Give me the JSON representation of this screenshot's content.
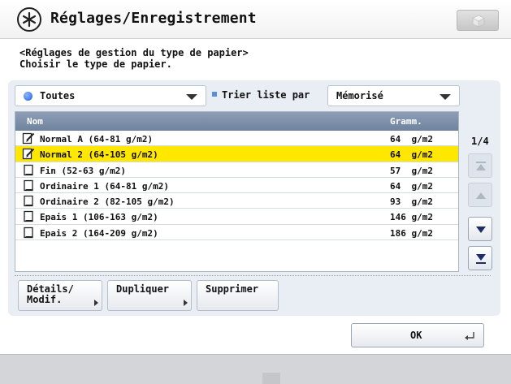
{
  "titlebar": {
    "title": "Réglages/Enregistrement",
    "icon": "settings-registration-icon",
    "right_button_icon": "box-icon"
  },
  "instructions": {
    "line1": "<Réglages de gestion du type de papier>",
    "line2": "Choisir le type de papier."
  },
  "filter": {
    "selected": "Toutes",
    "icon": "blue-dot-icon"
  },
  "sort": {
    "label": "Trier liste par",
    "selected": "Mémorisé"
  },
  "table": {
    "headers": {
      "name": "Nom",
      "weight": "Gramm."
    },
    "rows": [
      {
        "name": "Normal A (64-81 g/m2)",
        "weight": "64  g/m2",
        "icon": "edit-paper-icon",
        "selected": false
      },
      {
        "name": "Normal 2 (64-105 g/m2)",
        "weight": "64  g/m2",
        "icon": "edit-paper-icon",
        "selected": true
      },
      {
        "name": "Fin (52-63 g/m2)",
        "weight": "57  g/m2",
        "icon": "paper-icon",
        "selected": false
      },
      {
        "name": "Ordinaire 1 (64-81 g/m2)",
        "weight": "64  g/m2",
        "icon": "paper-icon",
        "selected": false
      },
      {
        "name": "Ordinaire 2 (82-105 g/m2)",
        "weight": "93  g/m2",
        "icon": "paper-icon",
        "selected": false
      },
      {
        "name": "Epais 1 (106-163 g/m2)",
        "weight": "146 g/m2",
        "icon": "paper-icon",
        "selected": false
      },
      {
        "name": "Epais 2 (164-209 g/m2)",
        "weight": "186 g/m2",
        "icon": "paper-icon",
        "selected": false
      }
    ]
  },
  "pager": {
    "indicator": "1/4"
  },
  "buttons": {
    "details": "Détails/\nModif.",
    "duplicate": "Dupliquer",
    "delete": "Supprimer",
    "ok": "OK"
  },
  "colors": {
    "selected_row": "#ffe700",
    "header": "#7a8daa",
    "panel": "#e9edf4"
  }
}
